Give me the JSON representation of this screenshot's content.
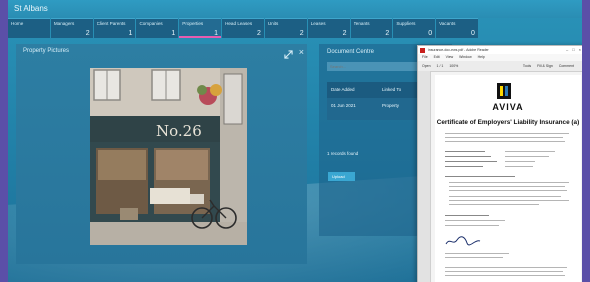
{
  "window": {
    "title": "St Albans"
  },
  "tabs": [
    {
      "label": "Home",
      "count": ""
    },
    {
      "label": "Managers",
      "count": "2"
    },
    {
      "label": "Client Parents",
      "count": "1"
    },
    {
      "label": "Companies",
      "count": "1"
    },
    {
      "label": "Properties",
      "count": "1",
      "active": true
    },
    {
      "label": "Head Leases",
      "count": "2"
    },
    {
      "label": "Units",
      "count": "2"
    },
    {
      "label": "Leases",
      "count": "2"
    },
    {
      "label": "Tenants",
      "count": "2"
    },
    {
      "label": "Suppliers",
      "count": "0"
    },
    {
      "label": "Vacants",
      "count": "0"
    }
  ],
  "property_pictures": {
    "title": "Property Pictures",
    "shop_sign": "No.26"
  },
  "document_centre": {
    "title": "Document Centre",
    "search_placeholder": "Search...",
    "columns": [
      "Date Added",
      "Linked To"
    ],
    "rows": [
      {
        "date_added": "01 Jun 2021",
        "linked_to": "Property"
      }
    ],
    "records_found": "1 records found",
    "upload_label": "Upload"
  },
  "pdf_viewer": {
    "window_title": "insurance-doc-ews.pdf - Adobe Reader",
    "menu": [
      "File",
      "Edit",
      "View",
      "Window",
      "Help"
    ],
    "toolbar_open": "Open",
    "toolbar_tools": [
      "Tools",
      "Fill & Sign",
      "Comment"
    ],
    "zoom": "100%",
    "page_indicator": "1 / 1",
    "document": {
      "brand": "AVIVA",
      "heading": "Certificate of Employers' Liability Insurance (a)"
    }
  },
  "colors": {
    "active_tab_accent": "#e85cb0",
    "app_background": "#2283aa",
    "brand_yellow": "#ffd900"
  }
}
